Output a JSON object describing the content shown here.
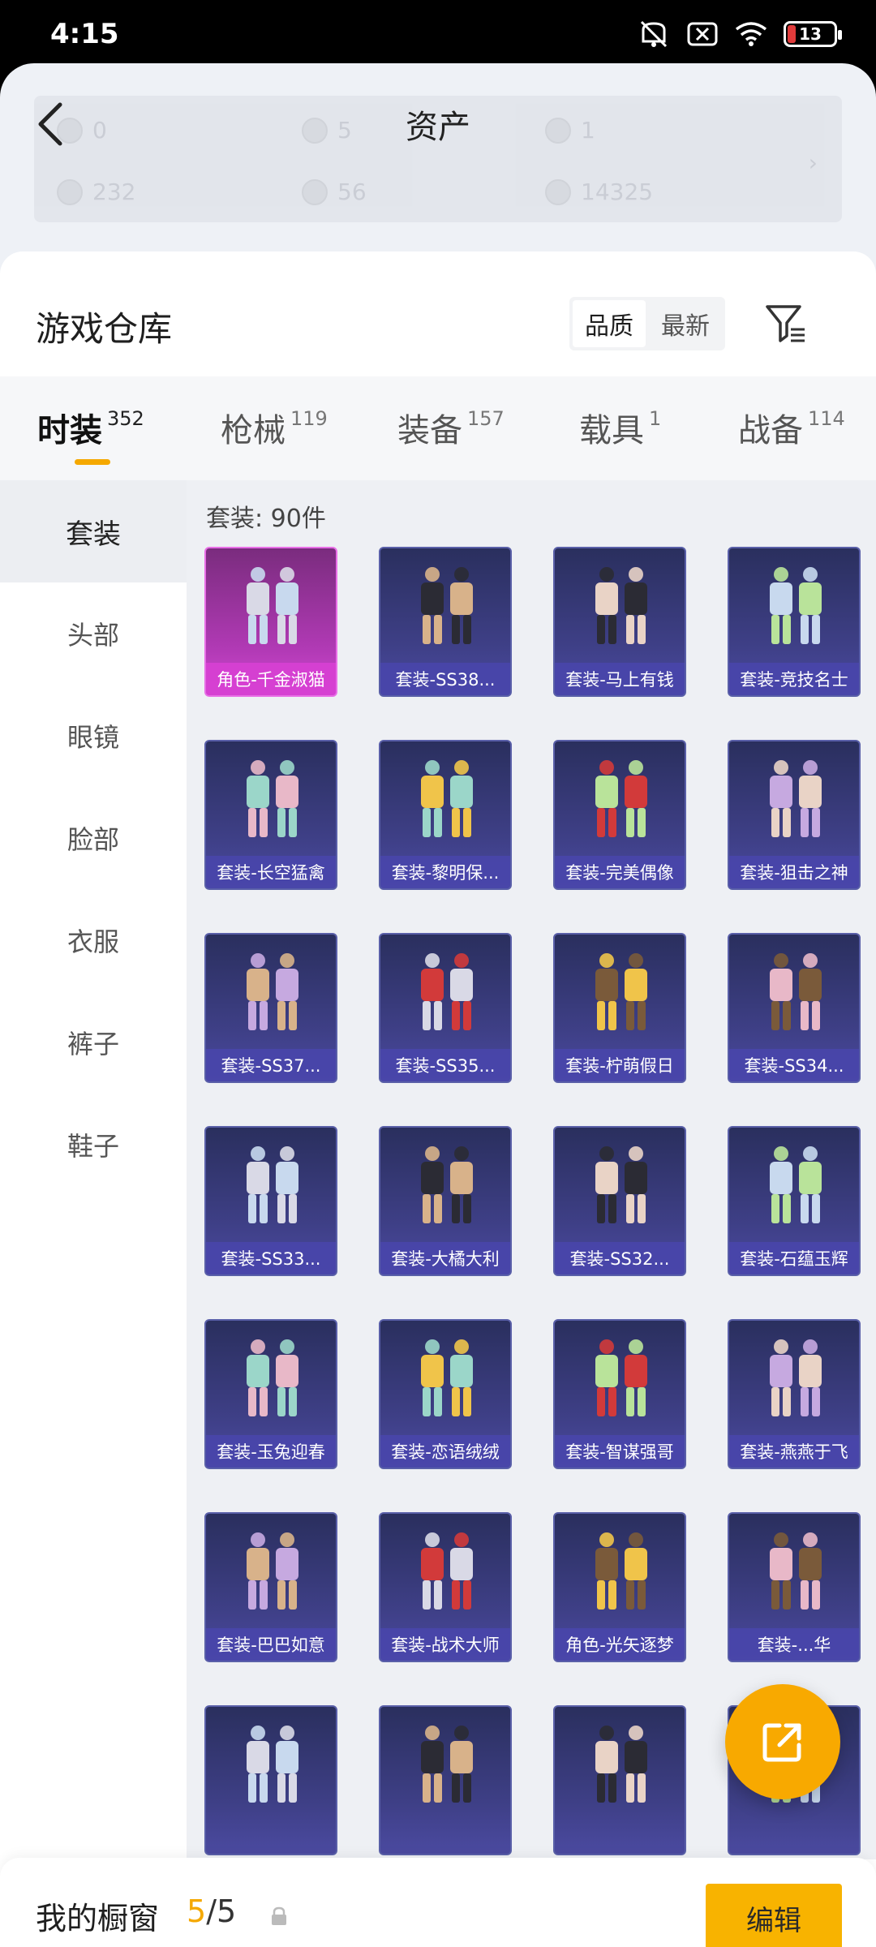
{
  "status_bar": {
    "time": "4:15",
    "battery": "13",
    "icons": [
      "mute-icon",
      "close-box-icon",
      "wifi-icon",
      "battery-icon"
    ]
  },
  "header": {
    "title": "资产",
    "assets": [
      {
        "value": "0",
        "icon": "coin-icon"
      },
      {
        "value": "5",
        "icon": "silver-coin-icon"
      },
      {
        "value": "1",
        "icon": "gold-emblem-icon"
      },
      {
        "value": "232",
        "icon": "ticket-icon"
      },
      {
        "value": "56",
        "icon": "pearl-icon"
      },
      {
        "value": "14325",
        "icon": "shell-icon"
      }
    ]
  },
  "warehouse": {
    "title": "游戏仓库",
    "sort": {
      "quality": "品质",
      "newest": "最新",
      "selected": "品质"
    }
  },
  "tabs": [
    {
      "label": "时装",
      "count": "352",
      "active": true
    },
    {
      "label": "枪械",
      "count": "119",
      "active": false
    },
    {
      "label": "装备",
      "count": "157",
      "active": false
    },
    {
      "label": "载具",
      "count": "1",
      "active": false
    },
    {
      "label": "战备",
      "count": "114",
      "active": false
    }
  ],
  "subnav": [
    {
      "label": "套装",
      "active": true
    },
    {
      "label": "头部",
      "active": false
    },
    {
      "label": "眼镜",
      "active": false
    },
    {
      "label": "脸部",
      "active": false
    },
    {
      "label": "衣服",
      "active": false
    },
    {
      "label": "裤子",
      "active": false
    },
    {
      "label": "鞋子",
      "active": false
    }
  ],
  "grid": {
    "label": "套装: 90件",
    "items": [
      {
        "name": "角色-千金淑猫",
        "rarity": "purple"
      },
      {
        "name": "套装-SS38...",
        "rarity": "blue"
      },
      {
        "name": "套装-马上有钱",
        "rarity": "blue"
      },
      {
        "name": "套装-竞技名士",
        "rarity": "blue"
      },
      {
        "name": "套装-长空猛禽",
        "rarity": "blue"
      },
      {
        "name": "套装-黎明保...",
        "rarity": "blue"
      },
      {
        "name": "套装-完美偶像",
        "rarity": "blue"
      },
      {
        "name": "套装-狙击之神",
        "rarity": "blue"
      },
      {
        "name": "套装-SS37...",
        "rarity": "blue"
      },
      {
        "name": "套装-SS35...",
        "rarity": "blue"
      },
      {
        "name": "套装-柠萌假日",
        "rarity": "blue"
      },
      {
        "name": "套装-SS34...",
        "rarity": "blue"
      },
      {
        "name": "套装-SS33...",
        "rarity": "blue"
      },
      {
        "name": "套装-大橘大利",
        "rarity": "blue"
      },
      {
        "name": "套装-SS32...",
        "rarity": "blue"
      },
      {
        "name": "套装-石蕴玉辉",
        "rarity": "blue"
      },
      {
        "name": "套装-玉兔迎春",
        "rarity": "blue"
      },
      {
        "name": "套装-恋语绒绒",
        "rarity": "blue"
      },
      {
        "name": "套装-智谋强哥",
        "rarity": "blue"
      },
      {
        "name": "套装-燕燕于飞",
        "rarity": "blue"
      },
      {
        "name": "套装-巴巴如意",
        "rarity": "blue"
      },
      {
        "name": "套装-战术大师",
        "rarity": "blue"
      },
      {
        "name": "角色-光矢逐梦",
        "rarity": "blue"
      },
      {
        "name": "套装-...华",
        "rarity": "blue"
      },
      {
        "name": "",
        "rarity": "blue"
      },
      {
        "name": "",
        "rarity": "blue"
      },
      {
        "name": "",
        "rarity": "blue"
      },
      {
        "name": "",
        "rarity": "blue"
      }
    ]
  },
  "bottom_bar": {
    "title": "我的橱窗",
    "count_current": "5",
    "count_total": "/5",
    "edit_label": "编辑"
  },
  "colors": {
    "accent": "#F5A800",
    "item_blue": "#3E3F86",
    "item_purple": "#B23AB6"
  }
}
